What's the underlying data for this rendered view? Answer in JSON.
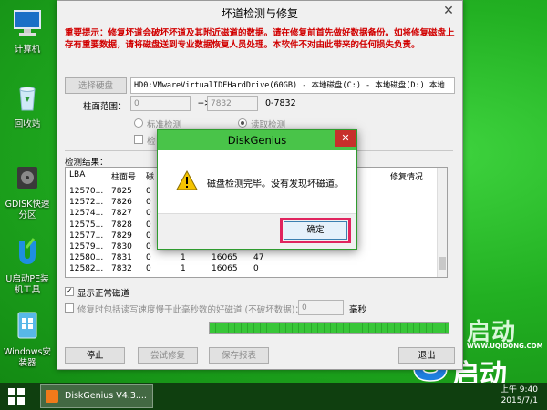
{
  "desktop": {
    "icons": [
      {
        "label": "计算机"
      },
      {
        "label": "回收站"
      },
      {
        "label": "GDISK快速分区"
      },
      {
        "label": "U启动PE装机工具"
      },
      {
        "label": "Windows安装器"
      }
    ],
    "brand": {
      "text": "启动",
      "url": "WWW.UQIDONG.COM"
    }
  },
  "window": {
    "title": "坏道检测与修复",
    "close_glyph": "✕",
    "warning": "重要提示：修复坏道会破坏坏道及其附近磁道的数据。请在修复前首先做好数据备份。如将修复磁盘上存有重要数据，请将磁盘送到专业数据恢复人员处理。本软件不对由此带来的任何损失负责。",
    "select_disk_button": "选择硬盘",
    "disk_field": "HD0:VMwareVirtualIDEHardDrive(60GB) - 本地磁盘(C:) - 本地磁盘(D:) 本地",
    "cylinder_label": "柱面范围：",
    "cylinder_from": "0",
    "cylinder_arrow": "-->",
    "cylinder_to": "7832",
    "cylinder_range": "0-7832",
    "radio_standard": "标准检测",
    "radio_read": "读取检测",
    "check_cut": "检",
    "result_label": "检测结果：",
    "table": {
      "headers": [
        "LBA",
        "柱面号",
        "磁",
        "修复情况"
      ],
      "rows": [
        {
          "lba": "12570...",
          "cyl": "7825",
          "head": "0",
          "c4": "",
          "c5": "",
          "c6": ""
        },
        {
          "lba": "12572...",
          "cyl": "7826",
          "head": "0",
          "c4": "",
          "c5": "",
          "c6": ""
        },
        {
          "lba": "12574...",
          "cyl": "7827",
          "head": "0",
          "c4": "",
          "c5": "",
          "c6": ""
        },
        {
          "lba": "12575...",
          "cyl": "7828",
          "head": "0",
          "c4": "",
          "c5": "",
          "c6": ""
        },
        {
          "lba": "12577...",
          "cyl": "7829",
          "head": "0",
          "c4": "",
          "c5": "",
          "c6": ""
        },
        {
          "lba": "12579...",
          "cyl": "7830",
          "head": "0",
          "c4": "",
          "c5": "",
          "c6": ""
        },
        {
          "lba": "12580...",
          "cyl": "7831",
          "head": "0",
          "c4": "1",
          "c5": "16065",
          "c6": "47"
        },
        {
          "lba": "12582...",
          "cyl": "7832",
          "head": "0",
          "c4": "1",
          "c5": "16065",
          "c6": "0"
        }
      ]
    },
    "show_normal": "显示正常磁道",
    "repair_slow": "修复时包括读写速度慢于此毫秒数的好磁道 (不破坏数据)：",
    "ms_value": "0",
    "ms_unit": "毫秒",
    "progress": 1.0,
    "stop_button": "停止",
    "try_repair_button": "尝试修复",
    "save_report_button": "保存报表",
    "exit_button": "退出"
  },
  "modal": {
    "title": "DiskGenius",
    "close_glyph": "✕",
    "message": "磁盘检测完毕。没有发现坏磁道。",
    "ok_button": "确定"
  },
  "taskbar": {
    "app_label": "DiskGenius V4.3....",
    "time": "上午 9:40",
    "date": "2015/7/1"
  }
}
